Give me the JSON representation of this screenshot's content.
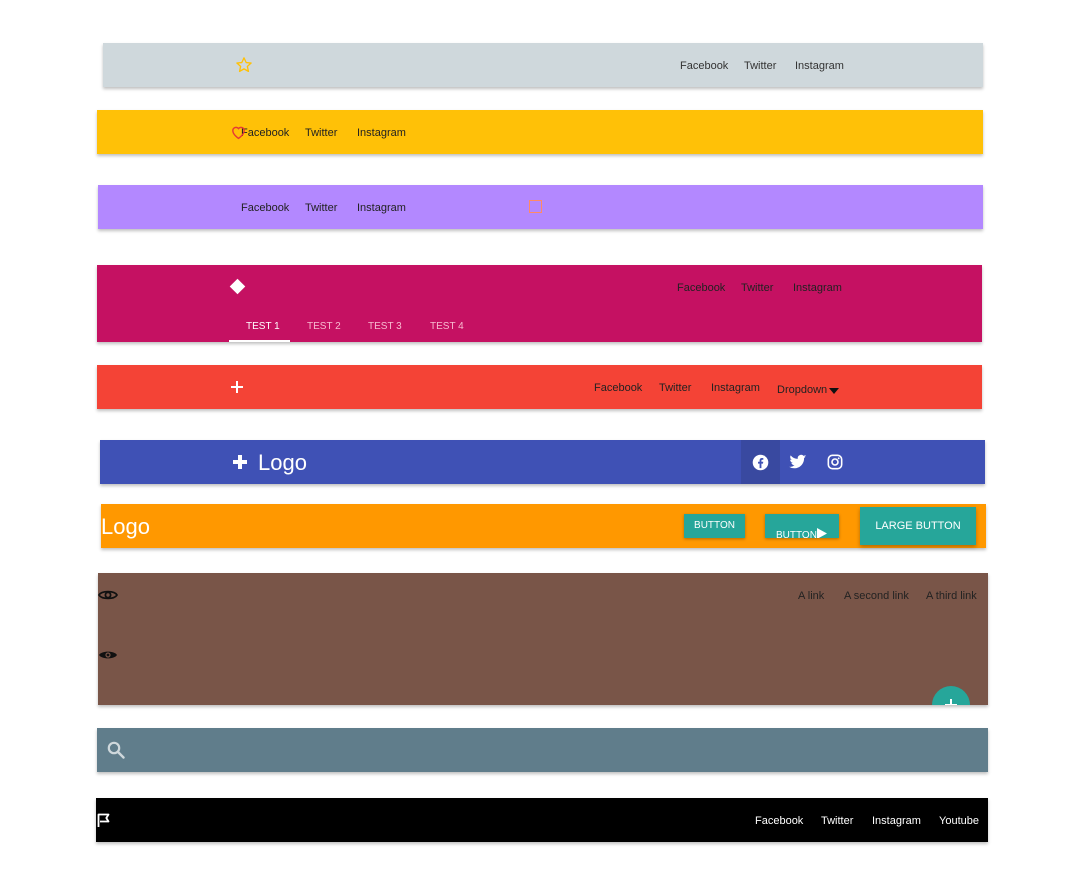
{
  "colors": {
    "bar1": "#cfd8dc",
    "bar2": "#ffc107",
    "bar3": "#b388ff",
    "bar4": "#c51162",
    "bar5": "#f44336",
    "bar6": "#3f51b5",
    "bar7": "#ff9800",
    "bar8": "#795548",
    "bar9": "#607d8b",
    "bar10": "#000000",
    "teal": "#26a69a"
  },
  "nav1": {
    "icon": "star-icon",
    "links": [
      "Facebook",
      "Twitter",
      "Instagram"
    ]
  },
  "nav2": {
    "icon": "heart-icon",
    "links": [
      "Facebook",
      "Twitter",
      "Instagram"
    ]
  },
  "nav3": {
    "icon": "square-icon",
    "links": [
      "Facebook",
      "Twitter",
      "Instagram"
    ]
  },
  "nav4": {
    "icon": "diamond-icon",
    "links": [
      "Facebook",
      "Twitter",
      "Instagram"
    ],
    "tabs": [
      "TEST 1",
      "TEST 2",
      "TEST 3",
      "TEST 4"
    ],
    "active_tab": 0
  },
  "nav5": {
    "icon": "plus-icon",
    "links": [
      "Facebook",
      "Twitter",
      "Instagram"
    ],
    "dropdown": "Dropdown"
  },
  "nav6": {
    "logo": "Logo",
    "icons": [
      "facebook-icon",
      "twitter-icon",
      "instagram-icon"
    ]
  },
  "nav7": {
    "logo": "Logo",
    "buttons": [
      "BUTTON",
      "BUTTON",
      "LARGE BUTTON"
    ]
  },
  "nav8": {
    "icons": [
      "eye-outline-icon",
      "eye-icon"
    ],
    "links": [
      "A link",
      "A second link",
      "A third link"
    ],
    "fab": "plus-icon"
  },
  "nav9": {
    "icon": "search-icon"
  },
  "nav10": {
    "icon": "flag-icon",
    "links": [
      "Facebook",
      "Twitter",
      "Instagram",
      "Youtube"
    ]
  }
}
